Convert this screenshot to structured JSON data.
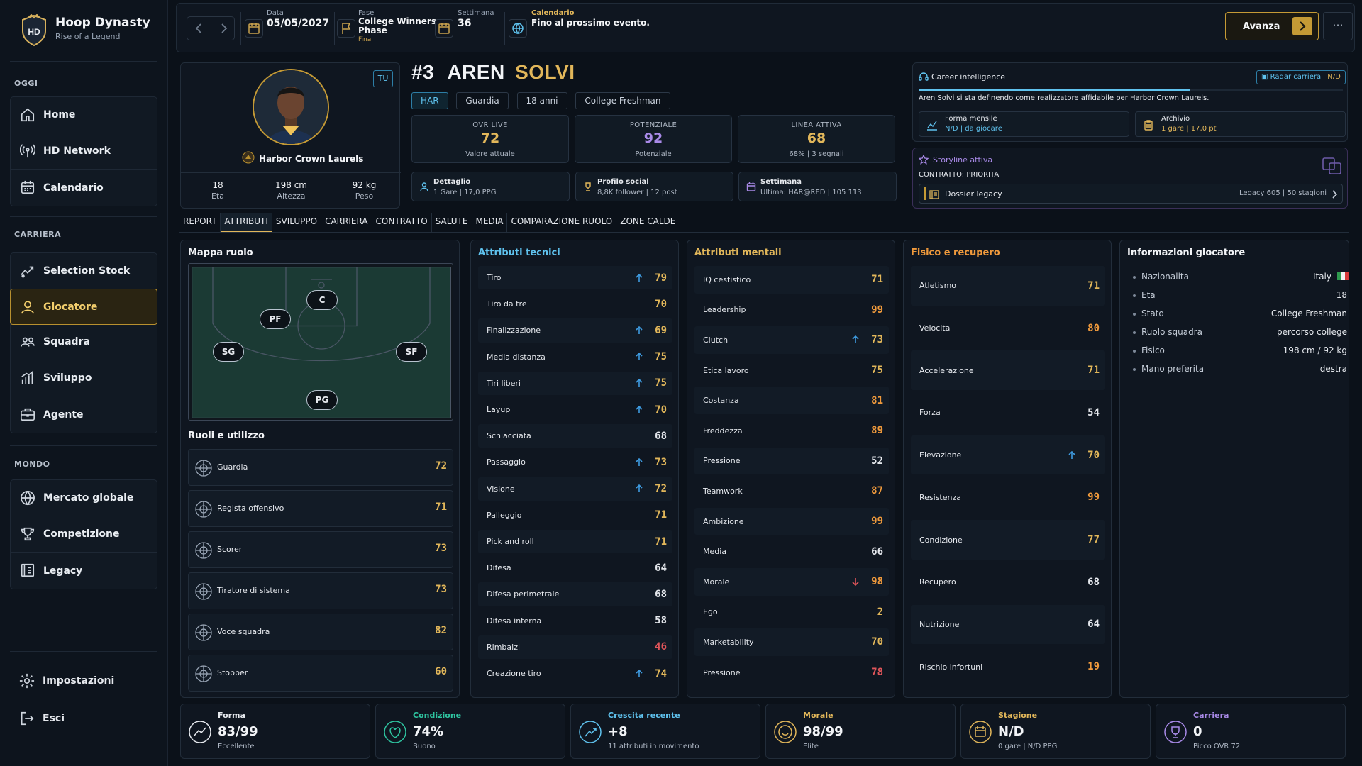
{
  "app": {
    "title": "Hoop Dynasty",
    "subtitle": "Rise of a Legend",
    "logo": "HD"
  },
  "sidebar": {
    "sections": [
      {
        "title": "OGGI",
        "items": [
          {
            "label": "Home",
            "icon": "home-icon"
          },
          {
            "label": "HD Network",
            "icon": "broadcast-icon"
          },
          {
            "label": "Calendario",
            "icon": "calendar-icon"
          }
        ]
      },
      {
        "title": "CARRIERA",
        "items": [
          {
            "label": "Selection Stock",
            "icon": "trend-icon"
          },
          {
            "label": "Giocatore",
            "icon": "user-icon",
            "active": true
          },
          {
            "label": "Squadra",
            "icon": "team-icon"
          },
          {
            "label": "Sviluppo",
            "icon": "bar-chart-icon"
          },
          {
            "label": "Agente",
            "icon": "briefcase-icon"
          }
        ]
      },
      {
        "title": "MONDO",
        "items": [
          {
            "label": "Mercato globale",
            "icon": "globe-icon"
          },
          {
            "label": "Competizione",
            "icon": "trophy-icon"
          },
          {
            "label": "Legacy",
            "icon": "building-icon"
          }
        ]
      }
    ],
    "footer": [
      {
        "label": "Impostazioni",
        "icon": "gear-icon"
      },
      {
        "label": "Esci",
        "icon": "logout-icon"
      }
    ]
  },
  "topbar": {
    "date": {
      "label": "Data",
      "value": "05/05/2027"
    },
    "phase": {
      "label": "Fase",
      "value_line1": "College Winners",
      "value_line2": "Phase",
      "sub": "Final"
    },
    "week": {
      "label": "Settimana",
      "value": "36"
    },
    "calendar": {
      "label": "Calendario",
      "value": "Fino al prossimo evento."
    },
    "advance_label": "Avanza",
    "more_label": "···"
  },
  "player": {
    "you_badge": "TU",
    "number": "#3",
    "first": "AREN",
    "last": "SOLVI",
    "team": "Harbor Crown Laurels",
    "tags": [
      "HAR",
      "Guardia",
      "18 anni",
      "College Freshman"
    ],
    "bio": [
      {
        "value": "18",
        "label": "Eta"
      },
      {
        "value": "198 cm",
        "label": "Altezza"
      },
      {
        "value": "92 kg",
        "label": "Peso"
      }
    ],
    "stats": [
      {
        "label": "OVR LIVE",
        "value": "72",
        "sub": "Valore attuale"
      },
      {
        "label": "POTENZIALE",
        "value": "92",
        "sub": "Potenziale"
      },
      {
        "label": "LINEA ATTIVA",
        "value": "68",
        "sub": "68% | 3 segnali"
      }
    ],
    "minis": [
      {
        "title": "Dettaglio",
        "desc": "1 Gare | 17,0 PPG",
        "icon": "person-icon"
      },
      {
        "title": "Profilo social",
        "desc": "8,8K follower | 12 post",
        "icon": "trophy-icon"
      },
      {
        "title": "Settimana",
        "desc": "Ultima: HAR@RED | 105 113",
        "icon": "calendar-icon"
      }
    ]
  },
  "career_intel": {
    "title": "Career intelligence",
    "radar": "Radar carriera",
    "radar_val": "N/D",
    "progress": 0.64,
    "text": "Aren Solvi si sta definendo come realizzatore affidabile per Harbor Crown Laurels.",
    "boxes": [
      {
        "title": "Forma mensile",
        "desc": "N/D | da giocare",
        "icon": "line-chart-icon"
      },
      {
        "title": "Archivio",
        "desc": "1 gare | 17,0 pt",
        "icon": "clipboard-icon"
      }
    ]
  },
  "storyline": {
    "title": "Storyline attiva",
    "contract": "CONTRATTO: PRIORITA",
    "dossier": "Dossier legacy",
    "dossier_val": "Legacy 605 | 50 stagioni"
  },
  "tabs": [
    "REPORT",
    "ATTRIBUTI",
    "SVILUPPO",
    "CARRIERA",
    "CONTRATTO",
    "SALUTE",
    "MEDIA",
    "COMPARAZIONE RUOLO",
    "ZONE CALDE"
  ],
  "active_tab": "ATTRIBUTI",
  "role_map": {
    "title": "Mappa ruolo",
    "positions": [
      "C",
      "PF",
      "SG",
      "SF",
      "PG"
    ]
  },
  "roles": {
    "title": "Ruoli e utilizzo",
    "items": [
      {
        "name": "Guardia",
        "value": "72"
      },
      {
        "name": "Regista offensivo",
        "value": "71"
      },
      {
        "name": "Scorer",
        "value": "73"
      },
      {
        "name": "Tiratore di sistema",
        "value": "73"
      },
      {
        "name": "Voce squadra",
        "value": "82"
      },
      {
        "name": "Stopper",
        "value": "60"
      }
    ]
  },
  "technical": {
    "title": "Attributi tecnici",
    "color": "#5fc2ee",
    "items": [
      {
        "name": "Tiro",
        "value": "79",
        "trend": "up"
      },
      {
        "name": "Tiro da tre",
        "value": "70",
        "trend": ""
      },
      {
        "name": "Finalizzazione",
        "value": "69",
        "trend": "up"
      },
      {
        "name": "Media distanza",
        "value": "75",
        "trend": "up"
      },
      {
        "name": "Tiri liberi",
        "value": "75",
        "trend": "up"
      },
      {
        "name": "Layup",
        "value": "70",
        "trend": "up"
      },
      {
        "name": "Schiacciata",
        "value": "68",
        "trend": ""
      },
      {
        "name": "Passaggio",
        "value": "73",
        "trend": "up"
      },
      {
        "name": "Visione",
        "value": "72",
        "trend": "up"
      },
      {
        "name": "Palleggio",
        "value": "71",
        "trend": ""
      },
      {
        "name": "Pick and roll",
        "value": "71",
        "trend": ""
      },
      {
        "name": "Difesa",
        "value": "64",
        "trend": ""
      },
      {
        "name": "Difesa perimetrale",
        "value": "68",
        "trend": ""
      },
      {
        "name": "Difesa interna",
        "value": "58",
        "trend": ""
      },
      {
        "name": "Rimbalzi",
        "value": "46",
        "trend": ""
      },
      {
        "name": "Creazione tiro",
        "value": "74",
        "trend": "up"
      }
    ]
  },
  "mental": {
    "title": "Attributi mentali",
    "color": "#e2b75a",
    "items": [
      {
        "name": "IQ cestistico",
        "value": "71",
        "trend": ""
      },
      {
        "name": "Leadership",
        "value": "99",
        "trend": ""
      },
      {
        "name": "Clutch",
        "value": "73",
        "trend": "up"
      },
      {
        "name": "Etica lavoro",
        "value": "75",
        "trend": ""
      },
      {
        "name": "Costanza",
        "value": "81",
        "trend": ""
      },
      {
        "name": "Freddezza",
        "value": "89",
        "trend": ""
      },
      {
        "name": "Pressione",
        "value": "52",
        "trend": ""
      },
      {
        "name": "Teamwork",
        "value": "87",
        "trend": ""
      },
      {
        "name": "Ambizione",
        "value": "99",
        "trend": ""
      },
      {
        "name": "Media",
        "value": "66",
        "trend": ""
      },
      {
        "name": "Morale",
        "value": "98",
        "trend": "down"
      },
      {
        "name": "Ego",
        "value": "2",
        "trend": ""
      },
      {
        "name": "Marketability",
        "value": "70",
        "trend": ""
      },
      {
        "name": "Pressione",
        "value": "78",
        "trend": ""
      }
    ]
  },
  "physical": {
    "title": "Fisico e recupero",
    "color": "#f09a3c",
    "items": [
      {
        "name": "Atletismo",
        "value": "71",
        "trend": ""
      },
      {
        "name": "Velocita",
        "value": "80",
        "trend": ""
      },
      {
        "name": "Accelerazione",
        "value": "71",
        "trend": ""
      },
      {
        "name": "Forza",
        "value": "54",
        "trend": ""
      },
      {
        "name": "Elevazione",
        "value": "70",
        "trend": "up"
      },
      {
        "name": "Resistenza",
        "value": "99",
        "trend": ""
      },
      {
        "name": "Condizione",
        "value": "77",
        "trend": ""
      },
      {
        "name": "Recupero",
        "value": "68",
        "trend": ""
      },
      {
        "name": "Nutrizione",
        "value": "64",
        "trend": ""
      },
      {
        "name": "Rischio infortuni",
        "value": "19",
        "trend": ""
      }
    ]
  },
  "info": {
    "title": "Informazioni giocatore",
    "items": [
      {
        "key": "Nazionalita",
        "value": "Italy"
      },
      {
        "key": "Eta",
        "value": "18"
      },
      {
        "key": "Stato",
        "value": "College Freshman"
      },
      {
        "key": "Ruolo squadra",
        "value": "percorso college"
      },
      {
        "key": "Fisico",
        "value": "198 cm / 92 kg"
      },
      {
        "key": "Mano preferita",
        "value": "destra"
      }
    ]
  },
  "bottom": [
    {
      "label": "Forma",
      "value": "83/99",
      "sub": "Eccellente",
      "color": "#e6e9ee",
      "icon": "trend-circle-icon"
    },
    {
      "label": "Condizione",
      "value": "74%",
      "sub": "Buono",
      "color": "#2ec4a0",
      "icon": "heart-icon"
    },
    {
      "label": "Crescita recente",
      "value": "+8",
      "sub": "11 attributi in movimento",
      "color": "#5fc2ee",
      "icon": "growth-icon"
    },
    {
      "label": "Morale",
      "value": "98/99",
      "sub": "Elite",
      "color": "#e2b75a",
      "icon": "smile-icon"
    },
    {
      "label": "Stagione",
      "value": "N/D",
      "sub": "0 gare | N/D PPG",
      "color": "#e2b75a",
      "icon": "calendar-icon"
    },
    {
      "label": "Carriera",
      "value": "0",
      "sub": "Picco OVR 72",
      "color": "#a98ae8",
      "icon": "trophy-icon"
    }
  ]
}
